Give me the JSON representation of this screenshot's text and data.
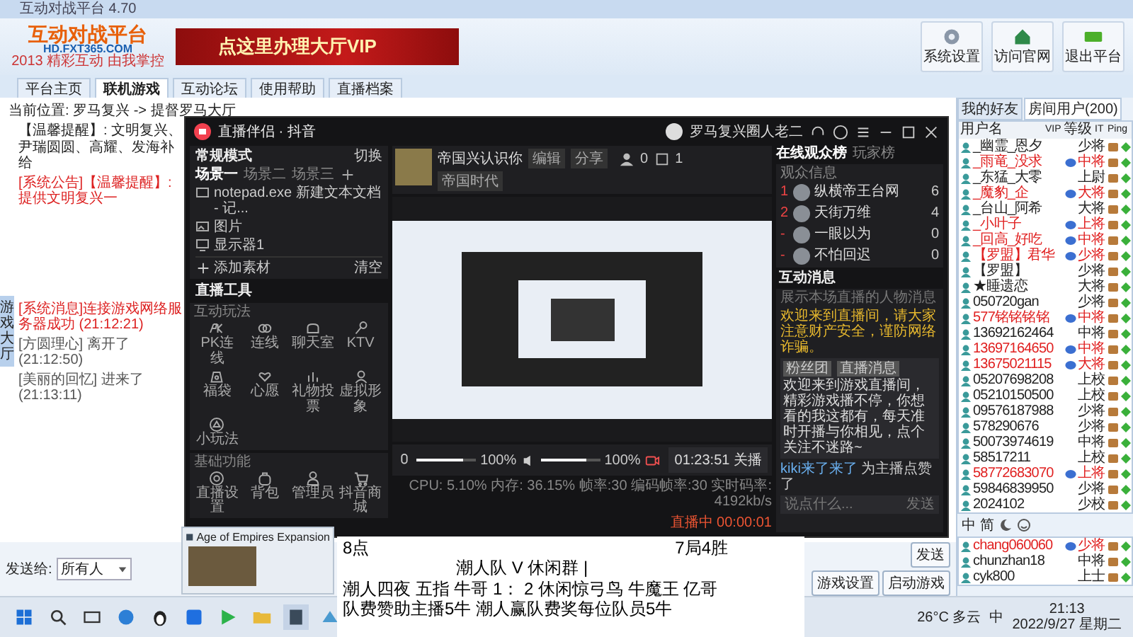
{
  "window": {
    "title": "互动对战平台 4.70"
  },
  "header": {
    "logo_title": "互动对战平台",
    "logo_url": "HD.FXT365.COM",
    "logo_slogan": "2013 精彩互动 由我掌控",
    "banner": "点这里办理大厅VIP",
    "actions": [
      {
        "kind": "settings",
        "label": "系统设置"
      },
      {
        "kind": "home",
        "label": "访问官网"
      },
      {
        "kind": "exit",
        "label": "退出平台"
      }
    ]
  },
  "nav_tabs": [
    {
      "label": "平台主页",
      "selected": false
    },
    {
      "label": "联机游戏",
      "selected": true
    },
    {
      "label": "互动论坛",
      "selected": false
    },
    {
      "label": "使用帮助",
      "selected": false
    },
    {
      "label": "直播档案",
      "selected": false
    }
  ],
  "breadcrumb": "当前位置: 罗马复兴 -> 提督罗马大厅",
  "notices": [
    {
      "kind": "info",
      "text": "【温馨提醒】: 文明复兴、尹瑞圆圆、高耀、发海补给"
    },
    {
      "kind": "alert",
      "text": "[系统公告]【温馨提醒】: 提供文明复兴一"
    }
  ],
  "side_tab": "游戏大厅",
  "chat": [
    {
      "kind": "system",
      "text": "[系统消息]连接游戏网络服务器成功 (21:12:21)"
    },
    {
      "kind": "user",
      "text": "[方圆理心] 离开了 (21:12:50)"
    },
    {
      "kind": "user",
      "text": "[美丽的回忆] 进来了 (21:13:11)"
    }
  ],
  "send_bar": {
    "label": "发送给:",
    "target": "所有人",
    "send": "发送",
    "buttons": [
      "游戏设置",
      "启动游戏"
    ]
  },
  "user_panel": {
    "tabs": [
      {
        "label": "我的好友",
        "selected": false
      },
      {
        "label": "房间用户(200)",
        "selected": true
      }
    ],
    "columns": [
      "用户名",
      "VIP",
      "等级",
      "IT",
      "Ping"
    ],
    "rows": [
      {
        "name": "_幽霊_恩夕",
        "rank": "少将",
        "vip": false,
        "highlight": false
      },
      {
        "name": "_雨竜_没求",
        "rank": "中将",
        "vip": true,
        "highlight": true
      },
      {
        "name": "_东猛_大零",
        "rank": "上尉",
        "vip": false,
        "highlight": false
      },
      {
        "name": "_魔豹_企",
        "rank": "大将",
        "vip": true,
        "highlight": true
      },
      {
        "name": "_台山_阿希",
        "rank": "大将",
        "vip": false,
        "highlight": false
      },
      {
        "name": "_小叶子",
        "rank": "上将",
        "vip": true,
        "highlight": true
      },
      {
        "name": "_回高_好吃",
        "rank": "中将",
        "vip": true,
        "highlight": true
      },
      {
        "name": "【罗盟】君华",
        "rank": "少将",
        "vip": true,
        "highlight": true
      },
      {
        "name": "【罗盟】",
        "rank": "少将",
        "vip": false,
        "highlight": false
      },
      {
        "name": "★睡遗恋",
        "rank": "大将",
        "vip": false,
        "highlight": false
      },
      {
        "name": "050720gan",
        "rank": "少将",
        "vip": false,
        "highlight": false
      },
      {
        "name": "577铭铭铭铭",
        "rank": "中将",
        "vip": true,
        "highlight": true
      },
      {
        "name": "13692162464",
        "rank": "中将",
        "vip": false,
        "highlight": false
      },
      {
        "name": "13697164650",
        "rank": "中将",
        "vip": true,
        "highlight": true
      },
      {
        "name": "13675021115",
        "rank": "大将",
        "vip": true,
        "highlight": true
      },
      {
        "name": "05207698208",
        "rank": "上校",
        "vip": false,
        "highlight": false
      },
      {
        "name": "05210150500",
        "rank": "上校",
        "vip": false,
        "highlight": false
      },
      {
        "name": "09576187988",
        "rank": "少将",
        "vip": false,
        "highlight": false
      },
      {
        "name": "578290676",
        "rank": "少将",
        "vip": false,
        "highlight": false
      },
      {
        "name": "50073974619",
        "rank": "中将",
        "vip": false,
        "highlight": false
      },
      {
        "name": "58517211",
        "rank": "上校",
        "vip": false,
        "highlight": false
      },
      {
        "name": "58772683070",
        "rank": "上将",
        "vip": true,
        "highlight": true
      },
      {
        "name": "59846839950",
        "rank": "少将",
        "vip": false,
        "highlight": false
      },
      {
        "name": "2024102",
        "rank": "少校",
        "vip": false,
        "highlight": false
      }
    ],
    "input_tools": [
      "中",
      "简"
    ],
    "more_rows": [
      {
        "name": "chang060060",
        "rank": "少将",
        "vip": true,
        "highlight": true
      },
      {
        "name": "chunzhan18",
        "rank": "中将",
        "vip": false,
        "highlight": false
      },
      {
        "name": "cyk800",
        "rank": "上士",
        "vip": false,
        "highlight": false
      }
    ]
  },
  "stream": {
    "title": "直播伴侣 · 抖音",
    "user": "罗马复兴圈人老二",
    "mode": "常规模式",
    "switch": "切换",
    "scenes": [
      {
        "label": "场景一",
        "selected": true
      },
      {
        "label": "场景二",
        "selected": false
      },
      {
        "label": "场景三",
        "selected": false
      }
    ],
    "sources": [
      {
        "kind": "window",
        "label": "notepad.exe 新建文本文档 - 记..."
      },
      {
        "kind": "image",
        "label": "图片"
      },
      {
        "kind": "display",
        "label": "显示器1"
      }
    ],
    "add_source": "添加素材",
    "clear": "清空",
    "tools_title": "直播工具",
    "tool_groups": [
      {
        "title": "互动玩法",
        "tools": [
          {
            "kind": "pk",
            "label": "PK连线"
          },
          {
            "kind": "link",
            "label": "连线"
          },
          {
            "kind": "chat",
            "label": "聊天室"
          },
          {
            "kind": "mic",
            "label": "KTV"
          },
          {
            "kind": "bag",
            "label": "福袋"
          },
          {
            "kind": "heart",
            "label": "心愿"
          },
          {
            "kind": "chart",
            "label": "礼物投票"
          },
          {
            "kind": "person",
            "label": "虚拟形象"
          },
          {
            "kind": "game",
            "label": "小玩法"
          }
        ]
      },
      {
        "title": "基础功能",
        "tools": [
          {
            "kind": "settings",
            "label": "直播设置"
          },
          {
            "kind": "backpack",
            "label": "背包"
          },
          {
            "kind": "admin",
            "label": "管理员"
          },
          {
            "kind": "cart",
            "label": "抖音商城"
          }
        ]
      }
    ],
    "room_title": "帝国兴认识你",
    "room_tags": [
      "编辑",
      "分享"
    ],
    "category": "帝国时代",
    "viewers": "0",
    "likes": "1",
    "mic": {
      "level": 0.78,
      "reading": "100%"
    },
    "speaker": {
      "level": 0.78,
      "reading": "100%"
    },
    "timer": "01:23:51",
    "end_button": "关播",
    "stats": "CPU: 5.10%  内存: 36.15%  帧率:30  编码帧率:30  实时码率: 4192kb/s",
    "live_status": "直播中 00:00:01",
    "audience_tabs": [
      {
        "label": "在线观众榜",
        "selected": true
      },
      {
        "label": "玩家榜",
        "selected": false
      }
    ],
    "audience_header": "观众信息",
    "audience": [
      {
        "rank": "1",
        "name": "纵横帝王台网",
        "score": "6"
      },
      {
        "rank": "2",
        "name": "天街万维",
        "score": "4"
      },
      {
        "rank": "-",
        "name": "一眼以为",
        "score": "0"
      },
      {
        "rank": "-",
        "name": "不怕回迟",
        "score": "0"
      }
    ],
    "messages_title": "互动消息",
    "messages_empty": "展示本场直播的人物消息",
    "warning": "欢迎来到直播间，请大家注意财产安全，谨防网络诈骗。",
    "message": {
      "badges": [
        "粉丝团",
        "直播消息"
      ],
      "text": "欢迎来到游戏直播间，精彩游戏播不停，你想看的我这都有，每天准时开播与你相见，点个关注不迷路~"
    },
    "like": {
      "user": "kiki来了来了",
      "text": "为主播点赞了"
    },
    "input_placeholder": "说点什么...",
    "send": "发送"
  },
  "task_preview": {
    "title": "Age of Empires Expansion"
  },
  "overlay": {
    "top_left": "8点",
    "top_right": "7局4胜",
    "match": "潮人队 V 休闲群 |",
    "lines": [
      "潮人四夜 五指 牛哥 1： 2 休闲惊弓鸟 牛魔王 亿哥",
      "队费赞助主播5牛 潮人赢队费奖每位队员5牛"
    ]
  },
  "taskbar": {
    "weather": "26°C 多云",
    "ime": "中",
    "time": "21:13",
    "date": "2022/9/27 星期二"
  }
}
